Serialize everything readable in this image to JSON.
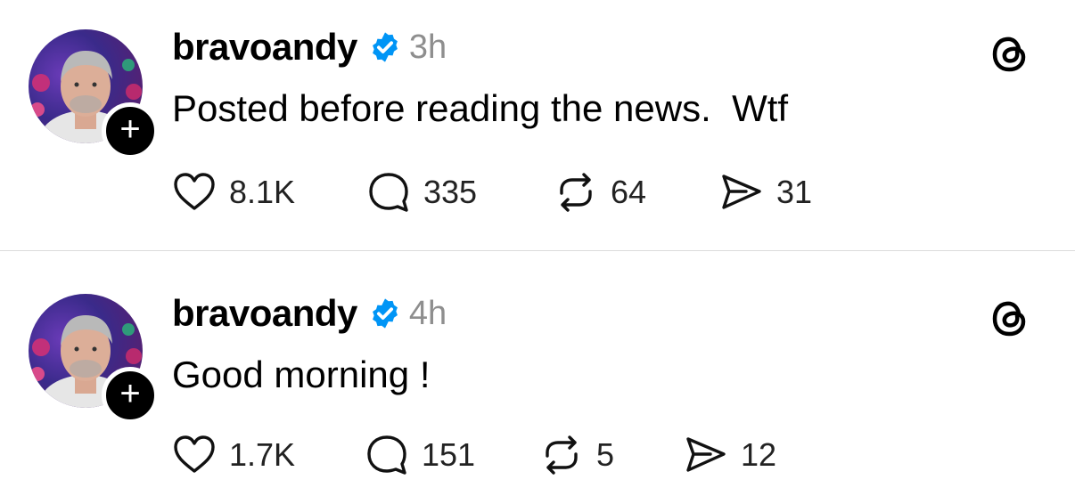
{
  "posts": [
    {
      "username": "bravoandy",
      "time": "3h",
      "text": "Posted before reading the news.  Wtf",
      "likes": "8.1K",
      "replies": "335",
      "reposts": "64",
      "shares": "31",
      "follow_glyph": "+"
    },
    {
      "username": "bravoandy",
      "time": "4h",
      "text": "Good morning !",
      "likes": "1.7K",
      "replies": "151",
      "reposts": "5",
      "shares": "12",
      "follow_glyph": "+"
    }
  ],
  "colors": {
    "verified": "#0095f6",
    "timestamp": "#8e8e8e",
    "divider": "#dcdcdc"
  },
  "icons": [
    "verified-badge-icon",
    "threads-logo-icon",
    "heart-icon",
    "reply-icon",
    "repost-icon",
    "share-icon",
    "plus-icon"
  ]
}
